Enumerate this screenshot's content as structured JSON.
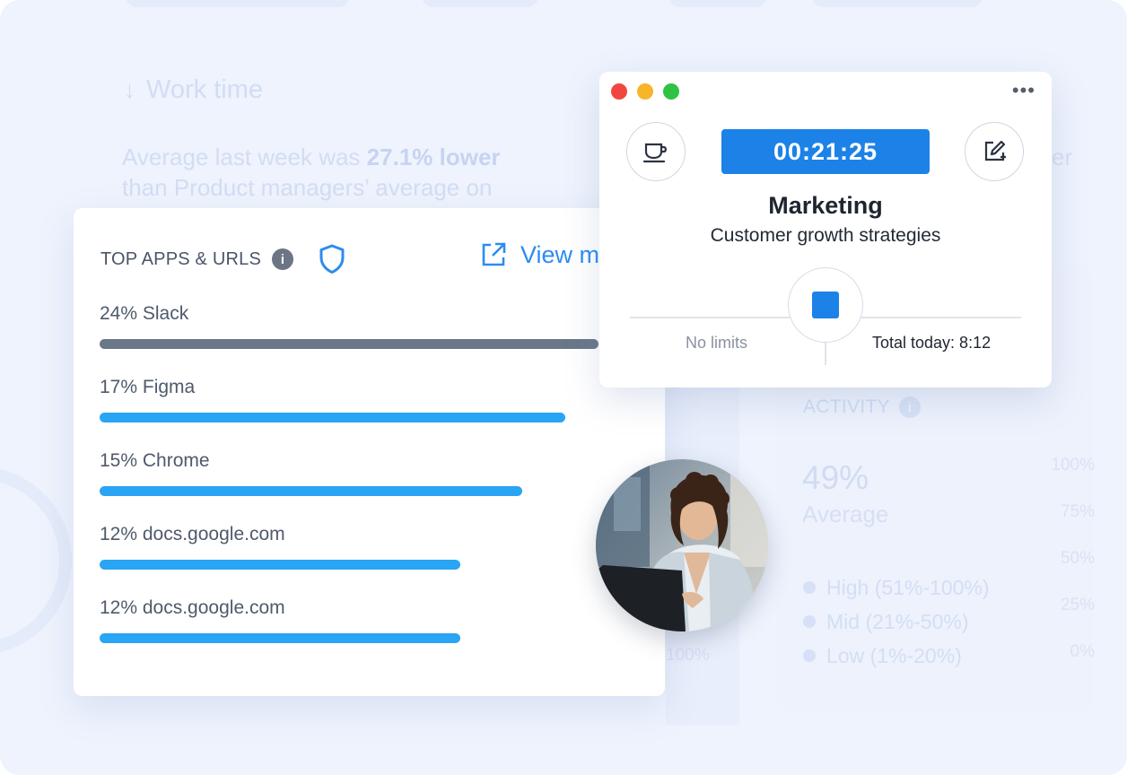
{
  "background": {
    "work_time_title": "Work time",
    "avg_text_prefix": "Average last week was ",
    "avg_text_bold": "27.1% lower",
    "avg_text_line2": "than Product managers’ average on",
    "right_fragment": "er",
    "activity": {
      "title": "ACTIVITY",
      "percent": "49%",
      "average_label": "Average",
      "legend": [
        "High (51%-100%)",
        "Mid (21%-50%)",
        "Low (1%-20%)"
      ],
      "axis": [
        "100%",
        "75%",
        "50%",
        "25%",
        "0%"
      ]
    },
    "bottom_axis_label": "100%"
  },
  "apps_card": {
    "title": "TOP APPS & URLS",
    "view_more_label": "View more",
    "items": [
      {
        "label": "24% Slack",
        "value": 24
      },
      {
        "label": "17% Figma",
        "value": 17
      },
      {
        "label": "15% Chrome",
        "value": 15
      },
      {
        "label": "12% docs.google.com",
        "value": 12
      },
      {
        "label": "12% docs.google.com",
        "value": 12
      }
    ]
  },
  "timer": {
    "time": "00:21:25",
    "project": "Marketing",
    "task": "Customer growth strategies",
    "limit_label": "No limits",
    "total_today": "Total today: 8:12"
  },
  "colors": {
    "accent": "#1c82e8",
    "bar": "#2aa4f4",
    "bar_top": "#697789",
    "background": "#eef3fd"
  },
  "icons": [
    "info-icon",
    "shield-icon",
    "external-link-icon",
    "coffee-cup-icon",
    "edit-icon",
    "stop-icon",
    "more-icon"
  ]
}
